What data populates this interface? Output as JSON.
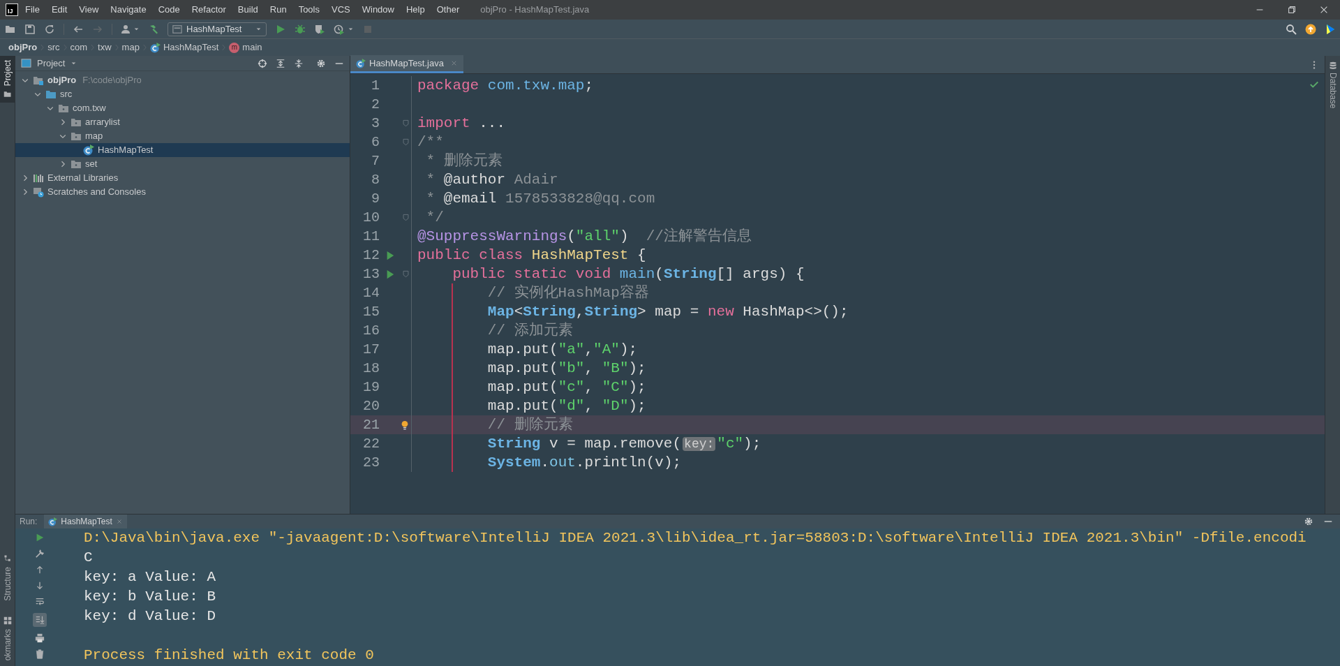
{
  "window": {
    "title": "objPro - HashMapTest.java",
    "logo_text": "IJ"
  },
  "menu": [
    "File",
    "Edit",
    "View",
    "Navigate",
    "Code",
    "Refactor",
    "Build",
    "Run",
    "Tools",
    "VCS",
    "Window",
    "Help",
    "Other"
  ],
  "toolbar": {
    "run_config": "HashMapTest"
  },
  "breadcrumb": [
    {
      "kind": "project",
      "label": "objPro"
    },
    {
      "kind": "dir",
      "label": "src"
    },
    {
      "kind": "dir",
      "label": "com"
    },
    {
      "kind": "dir",
      "label": "txw"
    },
    {
      "kind": "dir",
      "label": "map"
    },
    {
      "kind": "class",
      "label": "HashMapTest"
    },
    {
      "kind": "method",
      "badge": "m",
      "label": "main"
    }
  ],
  "left_stripe": [
    {
      "label": "Project",
      "selected": true
    },
    {
      "label": "Structure",
      "selected": false
    },
    {
      "label": "okmarks",
      "selected": false
    }
  ],
  "project_panel": {
    "title": "Project",
    "tree": [
      {
        "kind": "module",
        "label": "objPro",
        "path": "F:\\code\\objPro",
        "expanded": true,
        "selected": false,
        "children": [
          {
            "kind": "source",
            "label": "src",
            "expanded": true,
            "selected": false,
            "children": [
              {
                "kind": "package",
                "label": "com.txw",
                "expanded": true,
                "selected": false,
                "children": [
                  {
                    "kind": "package",
                    "label": "arrarylist",
                    "expanded": false,
                    "selected": false
                  },
                  {
                    "kind": "package",
                    "label": "map",
                    "expanded": true,
                    "selected": false,
                    "children": [
                      {
                        "kind": "class",
                        "label": "HashMapTest",
                        "selected": true
                      }
                    ]
                  },
                  {
                    "kind": "package",
                    "label": "set",
                    "expanded": false,
                    "selected": false
                  }
                ]
              }
            ]
          }
        ]
      },
      {
        "kind": "libraries",
        "label": "External Libraries",
        "expanded": false,
        "selected": false
      },
      {
        "kind": "scratches",
        "label": "Scratches and Consoles",
        "expanded": false,
        "selected": false
      }
    ]
  },
  "editor": {
    "tabs": [
      {
        "label": "HashMapTest.java",
        "selected": true
      }
    ],
    "lines": [
      {
        "number": "1",
        "tokens": [
          {
            "kind": "kw",
            "text": "package "
          },
          {
            "kind": "pkg",
            "text": "com.txw.map"
          },
          {
            "kind": "plain",
            "text": ";"
          }
        ]
      },
      {
        "number": "2"
      },
      {
        "number": "3",
        "fold": true,
        "tokens": [
          {
            "kind": "kw",
            "text": "import"
          },
          {
            "kind": "plain",
            "text": " ..."
          }
        ]
      },
      {
        "number": "6",
        "fold": true,
        "tokens": [
          {
            "kind": "doc",
            "text": "/**"
          }
        ]
      },
      {
        "number": "7",
        "tokens": [
          {
            "kind": "doc",
            "text": " * 删除元素"
          }
        ]
      },
      {
        "number": "8",
        "tokens": [
          {
            "kind": "doc",
            "text": " * "
          },
          {
            "kind": "doctag",
            "text": "@author"
          },
          {
            "kind": "doc",
            "text": " Adair"
          }
        ]
      },
      {
        "number": "9",
        "tokens": [
          {
            "kind": "doc",
            "text": " * "
          },
          {
            "kind": "doctag",
            "text": "@email"
          },
          {
            "kind": "doc",
            "text": " 1578533828@qq.com"
          }
        ]
      },
      {
        "number": "10",
        "fold": true,
        "tokens": [
          {
            "kind": "doc",
            "text": " */"
          }
        ]
      },
      {
        "number": "11",
        "tokens": [
          {
            "kind": "annotation",
            "text": "@SuppressWarnings"
          },
          {
            "kind": "plain",
            "text": "("
          },
          {
            "kind": "string",
            "text": "\"all\""
          },
          {
            "kind": "plain",
            "text": ")  "
          },
          {
            "kind": "comment",
            "text": "//注解警告信息"
          }
        ]
      },
      {
        "number": "12",
        "run": true,
        "tokens": [
          {
            "kind": "kw",
            "text": "public class "
          },
          {
            "kind": "cls",
            "text": "HashMapTest"
          },
          {
            "kind": "plain",
            "text": " {"
          }
        ]
      },
      {
        "number": "13",
        "run": true,
        "fold": true,
        "tokens": [
          {
            "kind": "kw",
            "text": "    public static void "
          },
          {
            "kind": "method",
            "text": "main"
          },
          {
            "kind": "plain",
            "text": "("
          },
          {
            "kind": "type",
            "text": "String"
          },
          {
            "kind": "plain",
            "text": "[] args) {"
          }
        ]
      },
      {
        "number": "14",
        "guide": true,
        "tokens": [
          {
            "kind": "comment",
            "text": "        // 实例化HashMap容器"
          }
        ]
      },
      {
        "number": "15",
        "guide": true,
        "tokens": [
          {
            "kind": "type",
            "text": "        Map"
          },
          {
            "kind": "plain",
            "text": "<"
          },
          {
            "kind": "type",
            "text": "String"
          },
          {
            "kind": "plain",
            "text": ","
          },
          {
            "kind": "type",
            "text": "String"
          },
          {
            "kind": "plain",
            "text": "> map = "
          },
          {
            "kind": "kw",
            "text": "new"
          },
          {
            "kind": "plain",
            "text": " HashMap<>();"
          }
        ]
      },
      {
        "number": "16",
        "guide": true,
        "tokens": [
          {
            "kind": "comment",
            "text": "        // 添加元素"
          }
        ]
      },
      {
        "number": "17",
        "guide": true,
        "tokens": [
          {
            "kind": "plain",
            "text": "        map.put("
          },
          {
            "kind": "string",
            "text": "\"a\""
          },
          {
            "kind": "plain",
            "text": ","
          },
          {
            "kind": "string",
            "text": "\"A\""
          },
          {
            "kind": "plain",
            "text": ");"
          }
        ]
      },
      {
        "number": "18",
        "guide": true,
        "tokens": [
          {
            "kind": "plain",
            "text": "        map.put("
          },
          {
            "kind": "string",
            "text": "\"b\""
          },
          {
            "kind": "plain",
            "text": ", "
          },
          {
            "kind": "string",
            "text": "\"B\""
          },
          {
            "kind": "plain",
            "text": ");"
          }
        ]
      },
      {
        "number": "19",
        "guide": true,
        "tokens": [
          {
            "kind": "plain",
            "text": "        map.put("
          },
          {
            "kind": "string",
            "text": "\"c\""
          },
          {
            "kind": "plain",
            "text": ", "
          },
          {
            "kind": "string",
            "text": "\"C\""
          },
          {
            "kind": "plain",
            "text": ");"
          }
        ]
      },
      {
        "number": "20",
        "guide": true,
        "tokens": [
          {
            "kind": "plain",
            "text": "        map.put("
          },
          {
            "kind": "string",
            "text": "\"d\""
          },
          {
            "kind": "plain",
            "text": ", "
          },
          {
            "kind": "string",
            "text": "\"D\""
          },
          {
            "kind": "plain",
            "text": ");"
          }
        ]
      },
      {
        "number": "21",
        "guide": true,
        "current": true,
        "bulb": true,
        "tokens": [
          {
            "kind": "comment",
            "text": "        // 删除元素"
          }
        ]
      },
      {
        "number": "22",
        "guide": true,
        "tokens": [
          {
            "kind": "type",
            "text": "        String"
          },
          {
            "kind": "plain",
            "text": " v = map.remove("
          },
          {
            "kind": "hint",
            "text": "key:"
          },
          {
            "kind": "string",
            "text": "\"c\""
          },
          {
            "kind": "plain",
            "text": ");"
          }
        ]
      },
      {
        "number": "23",
        "guide": true,
        "tokens": [
          {
            "kind": "type",
            "text": "        System"
          },
          {
            "kind": "plain",
            "text": "."
          },
          {
            "kind": "field",
            "text": "out"
          },
          {
            "kind": "plain",
            "text": ".println(v);"
          }
        ]
      }
    ]
  },
  "right_stripe": [
    {
      "label": "Database"
    }
  ],
  "run_panel": {
    "label": "Run:",
    "tabs": [
      {
        "label": "HashMapTest",
        "selected": true
      }
    ],
    "scroll_to_end": true,
    "console": [
      {
        "kind": "command",
        "text": "D:\\Java\\bin\\java.exe \"-javaagent:D:\\software\\IntelliJ IDEA 2021.3\\lib\\idea_rt.jar=58803:D:\\software\\IntelliJ IDEA 2021.3\\bin\" -Dfile.encodi"
      },
      {
        "kind": "output",
        "text": "C"
      },
      {
        "kind": "output",
        "text": "key: a Value: A"
      },
      {
        "kind": "output",
        "text": "key: b Value: B"
      },
      {
        "kind": "output",
        "text": "key: d Value: D"
      },
      {
        "kind": "blank"
      },
      {
        "kind": "exit",
        "text": "Process finished with exit code 0"
      }
    ]
  }
}
